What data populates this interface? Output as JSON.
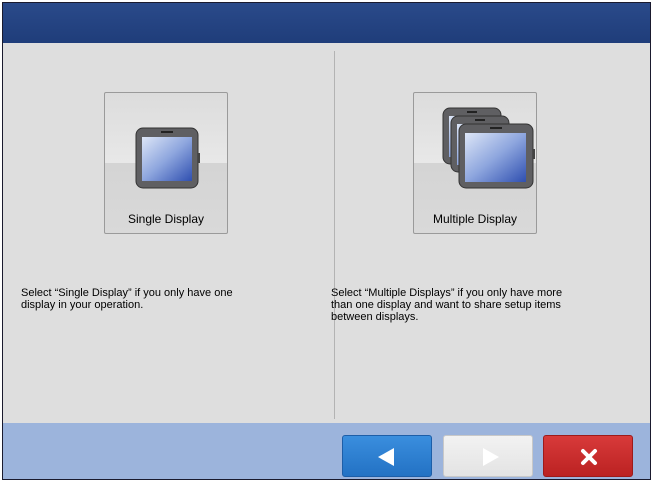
{
  "window": {
    "title": ""
  },
  "options": {
    "single": {
      "label": "Single Display",
      "icon": "display-icon",
      "description": "Select “Single Display” if you only have one\ndisplay in your operation."
    },
    "multiple": {
      "label": "Multiple Display",
      "icon": "multiple-displays-icon",
      "description": "Select “Multiple Displays” if you only have more\nthan one display and want to share setup items\nbetween displays."
    }
  },
  "navigation": {
    "back_icon": "triangle-left-icon",
    "next_icon": "triangle-right-icon",
    "next_enabled": false,
    "cancel_icon": "close-x-icon"
  },
  "colors": {
    "title_bar": "#1f3d7a",
    "content_bg": "#dedede",
    "bottom_bar": "#9cb4dc",
    "back_button": "#2a7dd2",
    "cancel_button": "#c62b2b",
    "next_button_disabled": "#ececec"
  }
}
